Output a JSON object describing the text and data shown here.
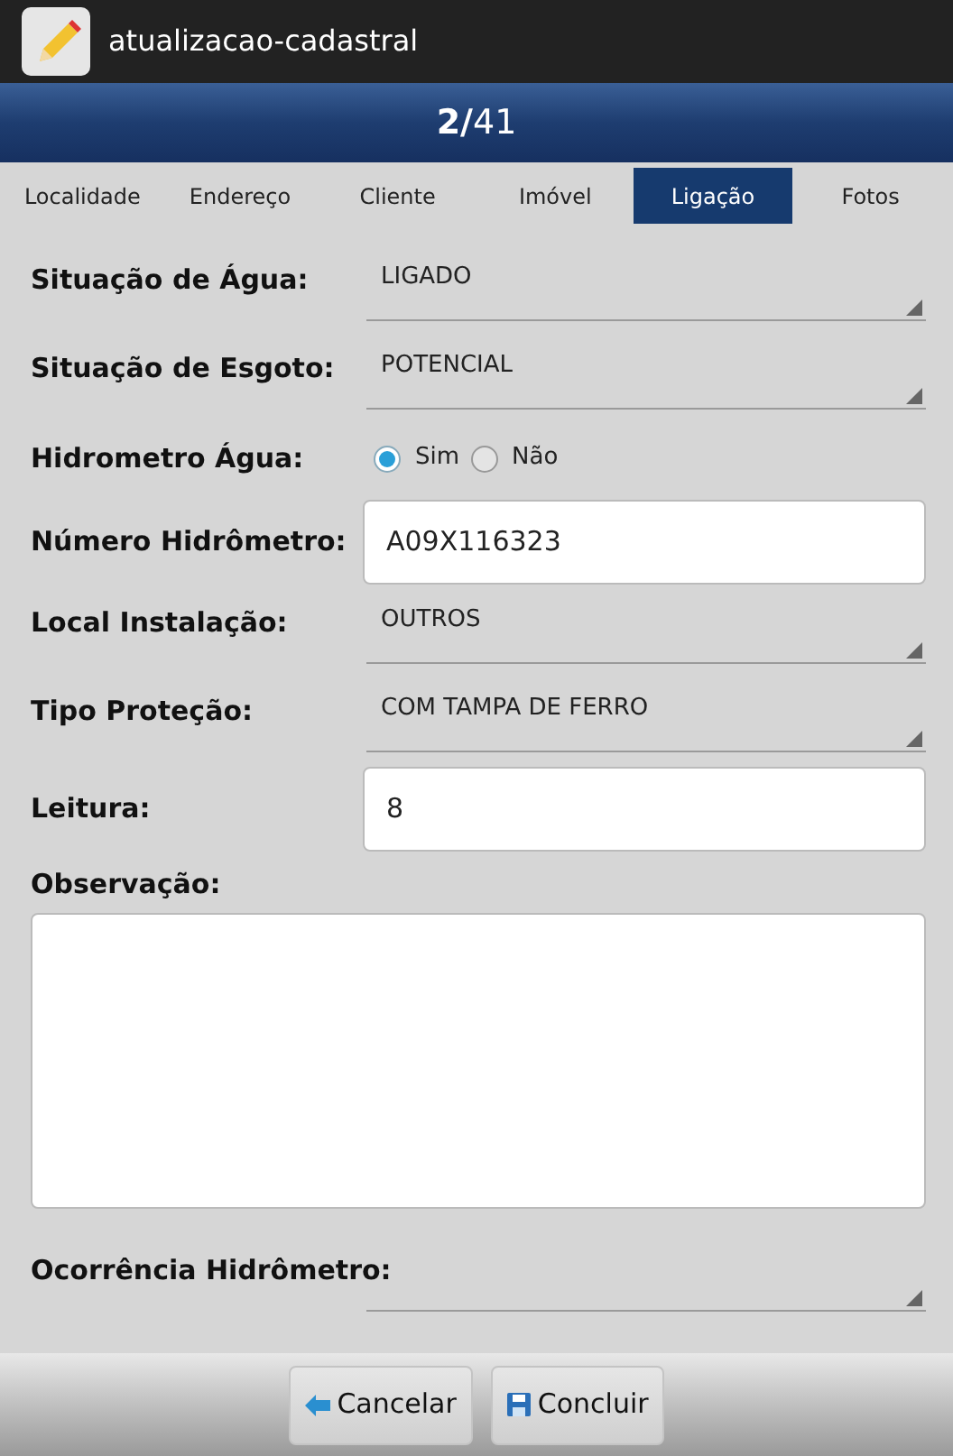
{
  "app_bar": {
    "title": "atualizacao-cadastral"
  },
  "pager": {
    "current": "2/",
    "total": "41"
  },
  "tabs": [
    {
      "label": "Localidade",
      "selected": false
    },
    {
      "label": "Endereço",
      "selected": false
    },
    {
      "label": "Cliente",
      "selected": false
    },
    {
      "label": "Imóvel",
      "selected": false
    },
    {
      "label": "Ligação",
      "selected": true
    },
    {
      "label": "Fotos",
      "selected": false
    }
  ],
  "fields": [
    {
      "kind": "select",
      "label": "Situação de Água:",
      "value": "LIGADO"
    },
    {
      "kind": "select",
      "label": "Situação de Esgoto:",
      "value": "POTENCIAL"
    },
    {
      "kind": "radio",
      "label": "Hidrometro Água:",
      "options": [
        {
          "label": "Sim",
          "selected": true
        },
        {
          "label": "Não",
          "selected": false
        }
      ]
    },
    {
      "kind": "text",
      "label": "Número Hidrômetro:",
      "value": "A09X116323"
    },
    {
      "kind": "select",
      "label": "Local Instalação:",
      "value": "OUTROS"
    },
    {
      "kind": "select",
      "label": "Tipo Proteção:",
      "value": "COM TAMPA DE FERRO"
    },
    {
      "kind": "text",
      "label": "Leitura:",
      "value": "8"
    },
    {
      "kind": "textarea",
      "label": "Observação:"
    },
    {
      "kind": "select",
      "label": "Ocorrência Hidrômetro:"
    }
  ],
  "buttons": [
    {
      "kind": "back",
      "label": "Cancelar"
    },
    {
      "kind": "save",
      "label": "Concluir"
    }
  ]
}
